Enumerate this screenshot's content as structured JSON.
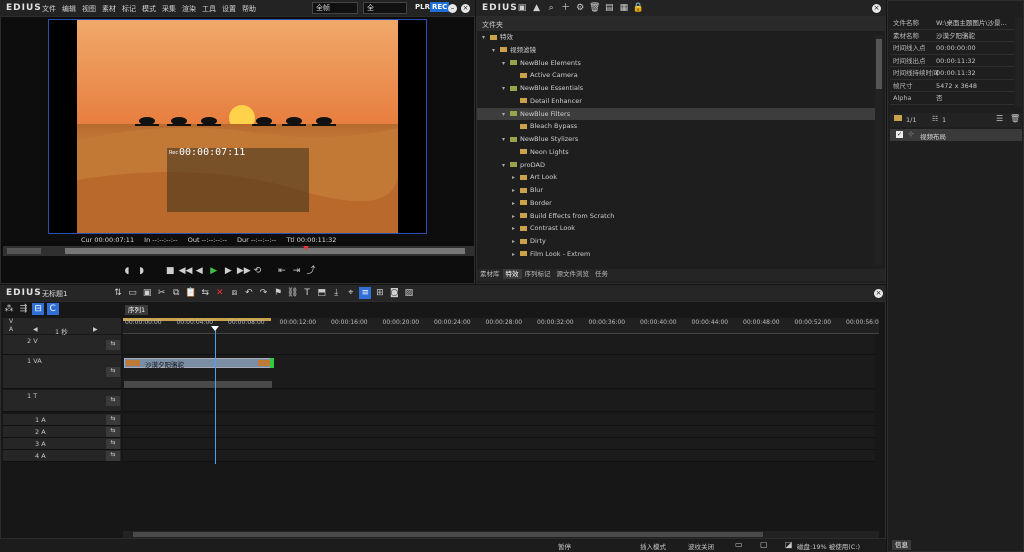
{
  "app": {
    "logo": "EDIUS",
    "menu": [
      "文件",
      "编辑",
      "视图",
      "素材",
      "标记",
      "模式",
      "采集",
      "渲染",
      "工具",
      "设置",
      "帮助"
    ],
    "select_frame": "全帧",
    "select_all": "全",
    "plr": "PLR",
    "rec": "REC"
  },
  "player": {
    "overlay_timecode": "00:00:07:11",
    "overlay_label": "Rec",
    "cur_label": "Cur",
    "cur": "00:00:07:11",
    "in_label": "In",
    "in": "--:--:--:--",
    "out_label": "Out",
    "out": "--:--:--:--",
    "dur_label": "Dur",
    "dur": "--:--:--:--",
    "ttl_label": "Ttl",
    "ttl": "00:00:11:32"
  },
  "library": {
    "logo": "EDIUS",
    "header": "文件夹",
    "tree": [
      {
        "label": "特效",
        "indent": 0,
        "arrow": "▾"
      },
      {
        "label": "视频滤镜",
        "indent": 1,
        "arrow": "▾"
      },
      {
        "label": "NewBlue Elements",
        "indent": 2,
        "arrow": "▾"
      },
      {
        "label": "Active Camera",
        "indent": 3,
        "arrow": ""
      },
      {
        "label": "NewBlue Essentials",
        "indent": 2,
        "arrow": "▾"
      },
      {
        "label": "Detail Enhancer",
        "indent": 3,
        "arrow": ""
      },
      {
        "label": "NewBlue Filters",
        "indent": 2,
        "arrow": "▾",
        "hl": true
      },
      {
        "label": "Bleach Bypass",
        "indent": 3,
        "arrow": ""
      },
      {
        "label": "NewBlue Stylizers",
        "indent": 2,
        "arrow": "▾"
      },
      {
        "label": "Neon Lights",
        "indent": 3,
        "arrow": ""
      },
      {
        "label": "proDAD",
        "indent": 2,
        "arrow": "▾"
      },
      {
        "label": "Art Look",
        "indent": 3,
        "arrow": "▸"
      },
      {
        "label": "Blur",
        "indent": 3,
        "arrow": "▸"
      },
      {
        "label": "Border",
        "indent": 3,
        "arrow": "▸"
      },
      {
        "label": "Build Effects from Scratch",
        "indent": 3,
        "arrow": "▸"
      },
      {
        "label": "Contrast Look",
        "indent": 3,
        "arrow": "▸"
      },
      {
        "label": "Dirty",
        "indent": 3,
        "arrow": "▸"
      },
      {
        "label": "Film Look - Extrem",
        "indent": 3,
        "arrow": "▸"
      }
    ],
    "tabs": [
      "素材库",
      "特效",
      "序列标记",
      "源文件浏览",
      "任务"
    ]
  },
  "props": {
    "rows": [
      {
        "k": "文件名称",
        "v": "W:\\桌面主题图片\\沙景..."
      },
      {
        "k": "素材名称",
        "v": "沙漠夕阳骆驼"
      },
      {
        "k": "时间线入点",
        "v": "00:00:00:00"
      },
      {
        "k": "时间线出点",
        "v": "00:00:11:32"
      },
      {
        "k": "时间线持续时间",
        "v": "00:00:11:32"
      },
      {
        "k": "帧尺寸",
        "v": "5472 x 3648"
      },
      {
        "k": "Alpha",
        "v": "否"
      }
    ],
    "page": "1/1",
    "count": "1",
    "effect_item": "视频布局",
    "info_tab": "信息"
  },
  "timeline": {
    "logo": "EDIUS",
    "project": "无标题1",
    "seq_tab": "序列1",
    "scale": "1 秒",
    "ruler": [
      "00:00:00:00",
      "00:00:04:00",
      "00:00:08:00",
      "00:00:12:00",
      "00:00:16:00",
      "00:00:20:00",
      "00:00:24:00",
      "00:00:28:00",
      "00:00:32:00",
      "00:00:36:00",
      "00:00:40:00",
      "00:00:44:00",
      "00:00:48:00",
      "00:00:52:00",
      "00:00:56:0"
    ],
    "tracks": [
      "2 V",
      "1 VA",
      "1 T",
      "1 A",
      "2 A",
      "3 A",
      "4 A"
    ],
    "clip": "沙漠夕阳骆驼",
    "vlabel": "V",
    "alabel": "A"
  },
  "status": {
    "items": [
      "暂停",
      "插入模式",
      "波纹关闭",
      "磁盘:19% 被使用(C:)"
    ]
  },
  "colors": {
    "accent": "#2f6fd6",
    "rec": "#1f6fd6",
    "clip": "#7a8ea6",
    "playhead": "#4aa0ff"
  }
}
